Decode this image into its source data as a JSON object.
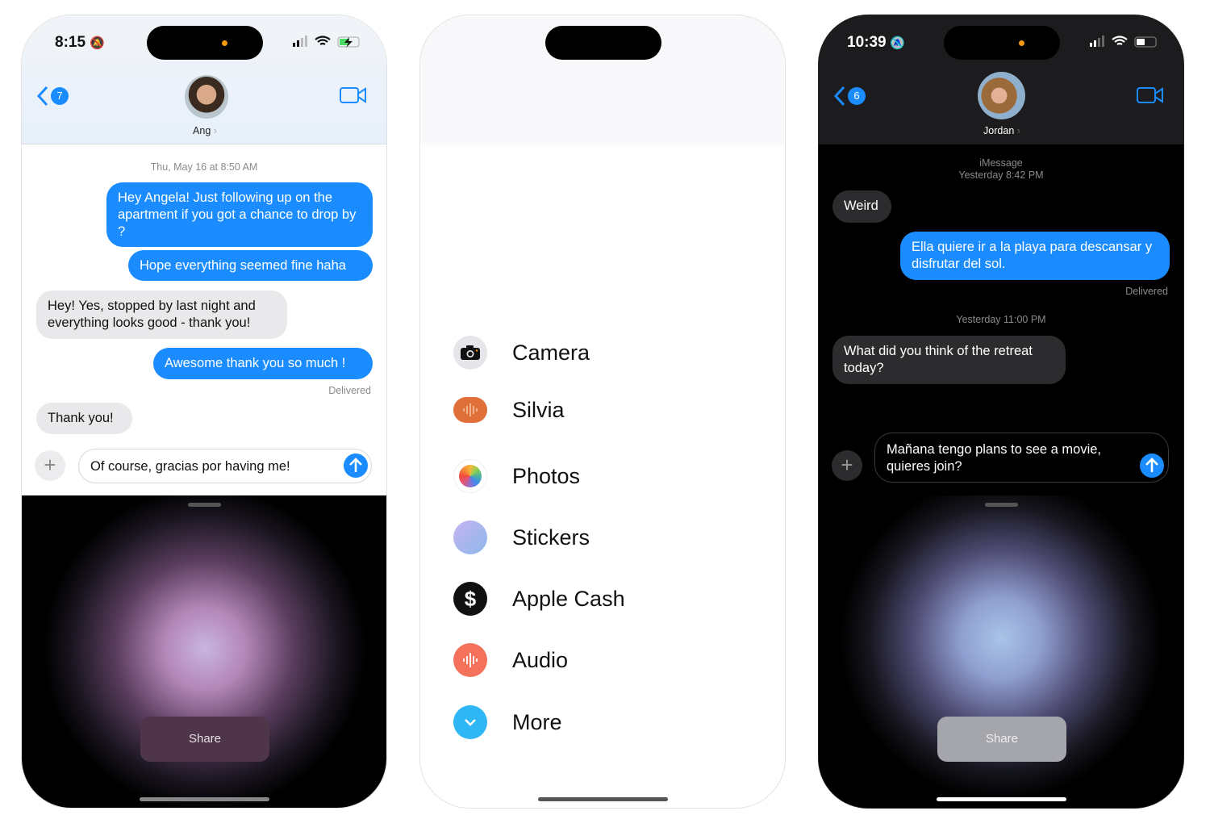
{
  "left_phone": {
    "status_time": "8:15",
    "back_count": "7",
    "contact_name": "Ang",
    "timestamp": "Thu, May 16 at 8:50 AM",
    "messages": [
      {
        "from": "me",
        "text": "Hey Angela! Just following up on the apartment if you got a chance to drop by ?"
      },
      {
        "from": "me",
        "text": "Hope everything seemed fine haha"
      },
      {
        "from": "them",
        "text": "Hey! Yes, stopped by last night and everything looks good - thank you!"
      },
      {
        "from": "me",
        "text": "Awesome thank you so much !"
      },
      {
        "from": "them",
        "text": "Thank you!"
      }
    ],
    "delivered": "Delivered",
    "composer_value": "Of course, gracias por having me!",
    "share_label": "Share"
  },
  "middle_phone": {
    "apps": [
      {
        "label": "Camera",
        "icon": "camera-icon",
        "color": "#e5e5ea"
      },
      {
        "label": "Silvia",
        "icon": "waveform-icon",
        "color": "#e0703a"
      },
      {
        "label": "Photos",
        "icon": "photos-icon",
        "color": "#ffffff"
      },
      {
        "label": "Stickers",
        "icon": "stickers-icon",
        "color": "#a9b8f0"
      },
      {
        "label": "Apple Cash",
        "icon": "dollar-icon",
        "color": "#111111"
      },
      {
        "label": "Audio",
        "icon": "audio-icon",
        "color": "#f4725b"
      },
      {
        "label": "More",
        "icon": "chevron-down-icon",
        "color": "#2fb6f5"
      }
    ]
  },
  "right_phone": {
    "status_time": "10:39",
    "back_count": "6",
    "contact_name": "Jordan",
    "service": "iMessage",
    "timestamp1": "Yesterday 8:42 PM",
    "messages": [
      {
        "from": "them",
        "text": "Weird"
      },
      {
        "from": "me",
        "text": "Ella quiere ir a la playa para descansar y disfrutar del sol."
      },
      {
        "from": "them",
        "text": "What did you think of the retreat today?"
      }
    ],
    "delivered": "Delivered",
    "timestamp2": "Yesterday 11:00 PM",
    "composer_value": "Mañana tengo plans to see a movie, quieres join?",
    "share_label": "Share"
  },
  "colors": {
    "accent": "#1a8cff"
  }
}
